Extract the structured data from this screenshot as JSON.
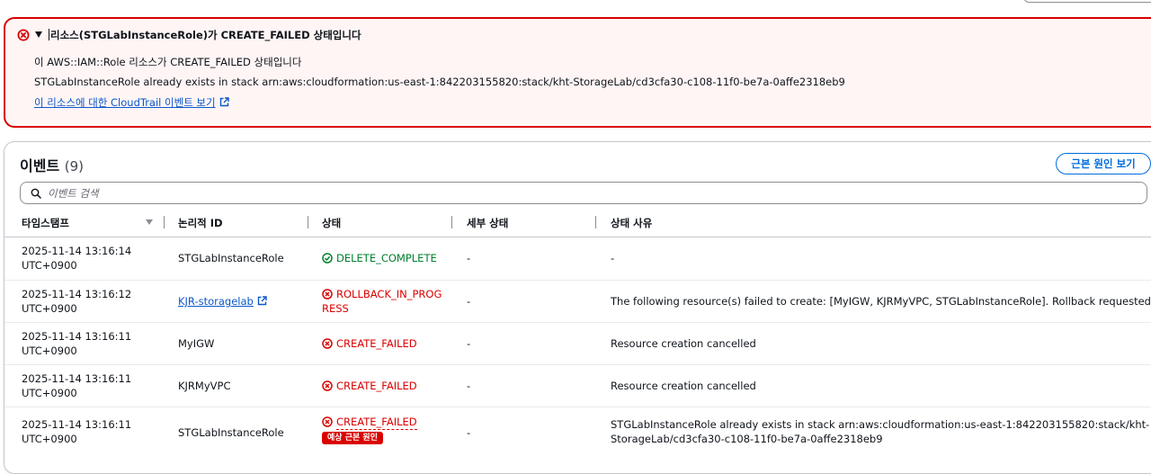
{
  "alert": {
    "icon": "error-circle-icon",
    "title": "리소스(STGLabInstanceRole)가 CREATE_FAILED 상태입니다",
    "line1": "이 AWS::IAM::Role 리소스가 CREATE_FAILED 상태입니다",
    "line2": "STGLabInstanceRole already exists in stack arn:aws:cloudformation:us-east-1:842203155820:stack/kht-StorageLab/cd3cfa30-c108-11f0-be7a-0affe2318eb9",
    "link": "이 리소스에 대한 CloudTrail 이벤트 보기",
    "colors": {
      "border": "#db0000",
      "background": "#fff5f5"
    }
  },
  "events": {
    "title": "이벤트",
    "count": "(9)",
    "root_cause_button": "근본 원인 보기",
    "search_placeholder": "이벤트 검색",
    "columns": [
      "타임스탬프",
      "논리적 ID",
      "상태",
      "세부 상태",
      "상태 사유"
    ],
    "rows": [
      {
        "time1": "2025-11-14 13:16:14",
        "time2": "UTC+0900",
        "logical_id": "STGLabInstanceRole",
        "status1": "DELETE_COMPLETE",
        "status2": "",
        "detail": "-",
        "reason1": "-",
        "reason2": ""
      },
      {
        "time1": "2025-11-14 13:16:12",
        "time2": "UTC+0900",
        "logical_id": "KJR-storagelab",
        "status1": "ROLLBACK_IN_PROG",
        "status2": "RESS",
        "detail": "-",
        "reason1": "The following resource(s) failed to create: [MyIGW, KJRMyVPC, STGLabInstanceRole]. Rollback requested by user.",
        "reason2": ""
      },
      {
        "time1": "2025-11-14 13:16:11",
        "time2": "UTC+0900",
        "logical_id": "MyIGW",
        "status1": "CREATE_FAILED",
        "status2": "",
        "detail": "-",
        "reason1": "Resource creation cancelled",
        "reason2": ""
      },
      {
        "time1": "2025-11-14 13:16:11",
        "time2": "UTC+0900",
        "logical_id": "KJRMyVPC",
        "status1": "CREATE_FAILED",
        "status2": "",
        "detail": "-",
        "reason1": "Resource creation cancelled",
        "reason2": ""
      },
      {
        "time1": "2025-11-14 13:16:11",
        "time2": "UTC+0900",
        "logical_id": "STGLabInstanceRole",
        "status1": "CREATE_FAILED",
        "status2": "",
        "badge": "예상 근본 원인",
        "detail": "-",
        "reason1": "STGLabInstanceRole already exists in stack arn:aws:cloudformation:us-east-1:842203155820:stack/kht-",
        "reason2": "StorageLab/cd3cfa30-c108-11f0-be7a-0affe2318eb9"
      }
    ]
  },
  "colors": {
    "success": "#00802f",
    "error": "#db0000",
    "link": "#0a58ca",
    "accent": "#006ce0"
  }
}
